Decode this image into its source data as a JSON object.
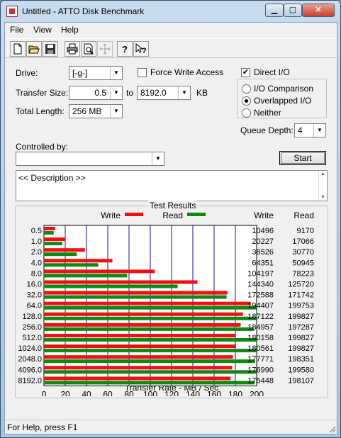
{
  "window": {
    "title": "Untitled - ATTO Disk Benchmark",
    "min_glyph": "▁",
    "max_glyph": "▢",
    "close_glyph": "✕"
  },
  "menu": [
    "File",
    "View",
    "Help"
  ],
  "toolbar": {
    "icons": [
      "new-file-icon",
      "open-folder-icon",
      "save-disk-icon",
      "print-icon",
      "print-preview-icon",
      "move-icon",
      "help-icon",
      "context-help-icon"
    ]
  },
  "settings": {
    "drive_label": "Drive:",
    "drive_value": "[-g-]",
    "transfer_size_label": "Transfer Size:",
    "transfer_from": "0.5",
    "to_label": "to",
    "transfer_to": "8192.0",
    "kb_label": "KB",
    "total_length_label": "Total Length:",
    "total_length_value": "256 MB",
    "force_write_access_label": "Force Write Access",
    "force_write_access_checked": false,
    "direct_io_label": "Direct I/O",
    "direct_io_checked": true,
    "io_comparison_label": "I/O Comparison",
    "overlapped_io_label": "Overlapped I/O",
    "neither_label": "Neither",
    "selected_io_mode": "Overlapped I/O",
    "queue_depth_label": "Queue Depth:",
    "queue_depth_value": "4",
    "controlled_by_label": "Controlled by:",
    "controlled_by_value": "",
    "start_label": "Start",
    "description_text": "<< Description >>"
  },
  "results": {
    "group_title": "Test Results",
    "write_legend": "Write",
    "read_legend": "Read",
    "write_header": "Write",
    "read_header": "Read",
    "write_color": "#ee1111",
    "read_color": "#118811"
  },
  "status": {
    "text": "For Help, press F1"
  },
  "chart_data": {
    "type": "bar",
    "orientation": "horizontal",
    "categories": [
      "0.5",
      "1.0",
      "2.0",
      "4.0",
      "8.0",
      "16.0",
      "32.0",
      "64.0",
      "128.0",
      "256.0",
      "512.0",
      "1024.0",
      "2048.0",
      "4096.0",
      "8192.0"
    ],
    "series": [
      {
        "name": "Write",
        "values": [
          10496,
          20227,
          38526,
          64351,
          104197,
          144340,
          172588,
          194407,
          187122,
          184957,
          180158,
          180561,
          177771,
          176990,
          175448
        ]
      },
      {
        "name": "Read",
        "values": [
          9170,
          17066,
          30770,
          50945,
          78223,
          125720,
          171742,
          199753,
          199827,
          197287,
          199827,
          199827,
          198351,
          199580,
          198107
        ]
      }
    ],
    "xlabel": "Transfer Rate - MB / Sec",
    "x_ticks": [
      "0",
      "20",
      "40",
      "60",
      "80",
      "100",
      "120",
      "140",
      "160",
      "180",
      "200"
    ],
    "xlim": [
      0,
      200
    ],
    "grid": true,
    "legend_position": "top"
  }
}
